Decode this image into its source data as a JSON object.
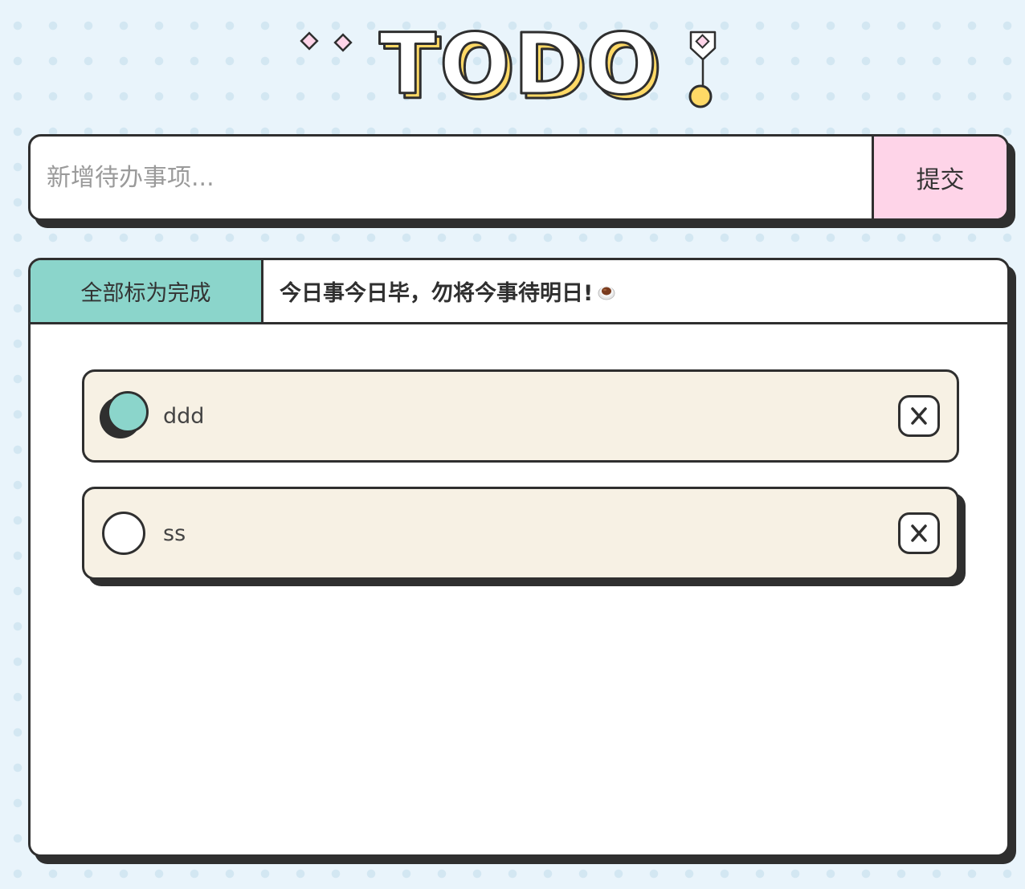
{
  "header": {
    "title": "TODO"
  },
  "input": {
    "placeholder": "新增待办事项...",
    "value": "",
    "submit_label": "提交"
  },
  "panel": {
    "mark_all_label": "全部标为完成",
    "motto": "今日事今日毕，勿将今事待明日!",
    "motto_icon": "coffee-icon"
  },
  "todos": [
    {
      "text": "ddd",
      "completed": true
    },
    {
      "text": "ss",
      "completed": false
    }
  ],
  "colors": {
    "background": "#e9f4fb",
    "accent_teal": "#8bd5cb",
    "accent_pink": "#fed4e8",
    "accent_yellow": "#ffd966",
    "item_background": "#f7f1e4",
    "ink": "#2f2f2f"
  }
}
